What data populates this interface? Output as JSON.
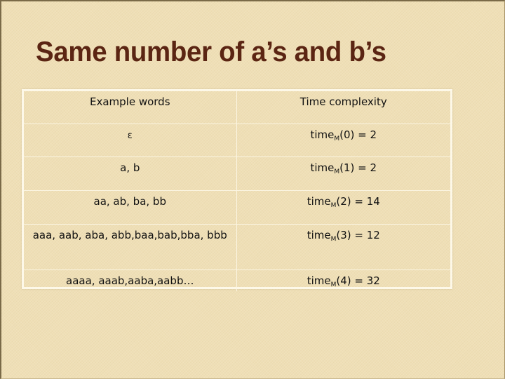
{
  "slide": {
    "title": "Same number of a’s and b’s"
  },
  "table": {
    "headers": [
      "Example words",
      "Time complexity"
    ],
    "rows": [
      {
        "words": "ε",
        "time_fn": "time",
        "subscript": "M",
        "arg": "(0) = 2"
      },
      {
        "words": "a, b",
        "time_fn": "time",
        "subscript": "M",
        "arg": "(1) = 2"
      },
      {
        "words": "aa, ab, ba, bb",
        "time_fn": "time",
        "subscript": "M",
        "arg": "(2) = 14"
      },
      {
        "words": "aaa, aab, aba, abb,baa,bab,bba, bbb",
        "time_fn": "time",
        "subscript": "M",
        "arg": "(3) = 12"
      },
      {
        "words": "aaaa, aaab,aaba,aabb…",
        "time_fn": "time",
        "subscript": "M",
        "arg": "(4) = 32"
      }
    ]
  },
  "colors": {
    "background": "#efdfb6",
    "title": "#5b2513",
    "table_lines": "#fbf5e2",
    "text": "#111111"
  }
}
